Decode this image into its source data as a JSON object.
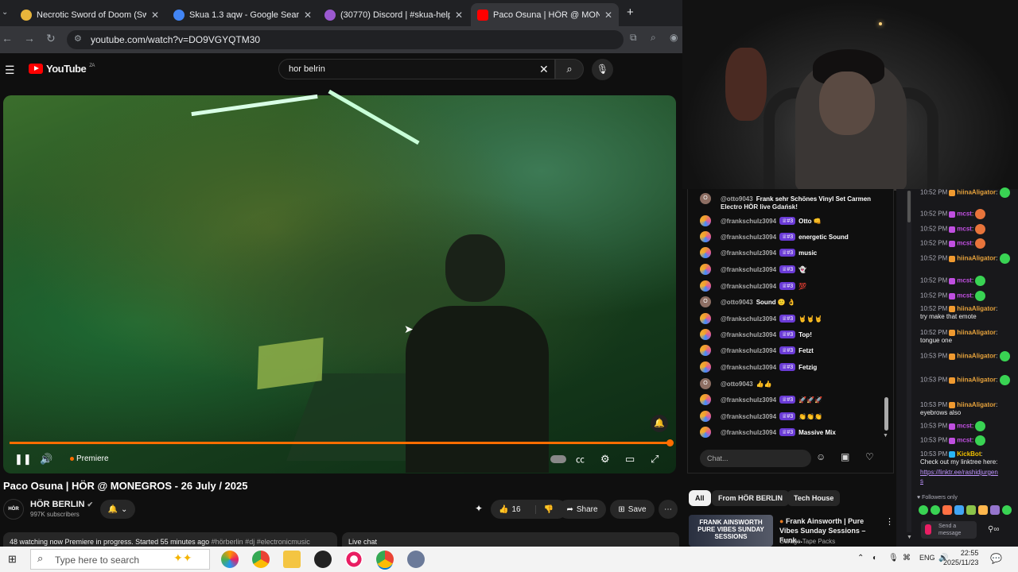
{
  "browser": {
    "tabs": [
      {
        "title": "Necrotic Sword of Doom (Swor",
        "color": "#e8b53b"
      },
      {
        "title": "Skua 1.3 aqw - Google Search",
        "color": "#4285f4"
      },
      {
        "title": "(30770) Discord | #skua-help | I",
        "color": "#9b59d0"
      },
      {
        "title": "Paco Osuna | HÖR @ MON",
        "color": "#ff0000"
      }
    ],
    "new_tab": "+",
    "url": "youtube.com/watch?v=DO9VGYQTM30"
  },
  "youtube": {
    "logo": "YouTube",
    "logo_sup": "ZA",
    "search_value": "hor belrin",
    "video": {
      "status": "Premiere",
      "title": "Paco Osuna | HÖR @ MONEGROS - 26 July / 2025",
      "channel": "HÖR BERLIN",
      "channel_avatar": "HÖR",
      "subscribers": "997K subscribers",
      "likes": "16",
      "share": "Share",
      "save": "Save",
      "description": "48 watching now  Premiere in progress. Started 55 minutes ago",
      "tags": "#hörberlin #dj #electronicmusic",
      "live_chat_label": "Live chat"
    },
    "chat": {
      "input_placeholder": "Chat...",
      "messages": [
        {
          "author": "@otto9043",
          "msg": "Frank sehr Schönes Vinyl Set Carmen",
          "badge": "",
          "av": "O"
        },
        {
          "author": "@frankschulz3094",
          "msg": "Otto 👊",
          "badge": "♕#3",
          "av": ""
        },
        {
          "author": "@frankschulz3094",
          "msg": "energetic Sound",
          "badge": "♕#3",
          "av": ""
        },
        {
          "author": "@frankschulz3094",
          "msg": "music",
          "badge": "♕#3",
          "av": ""
        },
        {
          "author": "@frankschulz3094",
          "msg": "👻",
          "badge": "♕#3",
          "av": ""
        },
        {
          "author": "@frankschulz3094",
          "msg": "💯",
          "badge": "♕#3",
          "av": ""
        },
        {
          "author": "@otto9043",
          "msg": "Sound 🙂 👌",
          "badge": "",
          "av": "O"
        },
        {
          "author": "@frankschulz3094",
          "msg": "🤘🤘🤘",
          "badge": "♕#3",
          "av": ""
        },
        {
          "author": "@frankschulz3094",
          "msg": "Top!",
          "badge": "♕#3",
          "av": ""
        },
        {
          "author": "@frankschulz3094",
          "msg": "Fetzt",
          "badge": "♕#3",
          "av": ""
        },
        {
          "author": "@frankschulz3094",
          "msg": "Fetzig",
          "badge": "♕#3",
          "av": ""
        },
        {
          "author": "@otto9043",
          "msg": "👍👍",
          "badge": "",
          "av": "O"
        },
        {
          "author": "@frankschulz3094",
          "msg": "🚀🚀🚀",
          "badge": "♕#3",
          "av": ""
        },
        {
          "author": "@frankschulz3094",
          "msg": "👏👏👏",
          "badge": "♕#3",
          "av": ""
        },
        {
          "author": "@frankschulz3094",
          "msg": "Massive Mix",
          "badge": "♕#3",
          "av": ""
        }
      ],
      "first_msg_cont": "Electro HÖR live Gdańsk!"
    },
    "chips": [
      "All",
      "From HÖR BERLIN",
      "Tech House"
    ],
    "recommended": {
      "thumb_text": "FRANK AINSWORTH PURE VIBES SUNDAY SESSIONS",
      "title": "Frank Ainsworth | Pure Vibes Sunday Sessions – Funk...",
      "channel": "Garage Tape Packs"
    }
  },
  "twitch": {
    "messages": [
      {
        "time": "10:52 PM",
        "user": "hiinaAligator",
        "color": "#e6a23c",
        "text": ""
      },
      {
        "time": "10:52 PM",
        "user": "mcst",
        "color": "#c04fe0",
        "text": ""
      },
      {
        "time": "10:52 PM",
        "user": "mcst",
        "color": "#c04fe0",
        "text": ""
      },
      {
        "time": "10:52 PM",
        "user": "mcst",
        "color": "#c04fe0",
        "text": ""
      },
      {
        "time": "10:52 PM",
        "user": "hiinaAligator",
        "color": "#e6a23c",
        "text": ""
      },
      {
        "time": "10:52 PM",
        "user": "mcst",
        "color": "#c04fe0",
        "text": ""
      },
      {
        "time": "10:52 PM",
        "user": "mcst",
        "color": "#c04fe0",
        "text": ""
      },
      {
        "time": "10:52 PM",
        "user": "hiinaAligator",
        "color": "#e6a23c",
        "text": "try make that emote"
      },
      {
        "time": "10:52 PM",
        "user": "hiinaAligator",
        "color": "#e6a23c",
        "text": "tongue one"
      },
      {
        "time": "10:53 PM",
        "user": "hiinaAligator",
        "color": "#e6a23c",
        "text": ""
      },
      {
        "time": "10:53 PM",
        "user": "hiinaAligator",
        "color": "#e6a23c",
        "text": ""
      },
      {
        "time": "10:53 PM",
        "user": "hiinaAligator",
        "color": "#e6a23c",
        "text": "eyebrows also"
      },
      {
        "time": "10:53 PM",
        "user": "mcst",
        "color": "#c04fe0",
        "text": ""
      },
      {
        "time": "10:53 PM",
        "user": "mcst",
        "color": "#c04fe0",
        "text": ""
      },
      {
        "time": "10:53 PM",
        "user": "KickBot",
        "color": "#f0c000",
        "text": "Check out my linktree here:"
      }
    ],
    "link": "https://linktr.ee/rashidjurgen",
    "link_cont": "s",
    "followers_only": "Followers only",
    "send_message": "Send a message"
  },
  "taskbar": {
    "search_placeholder": "Type here to search",
    "lang": "ENG",
    "time": "22:55",
    "date": "2025/11/23"
  }
}
